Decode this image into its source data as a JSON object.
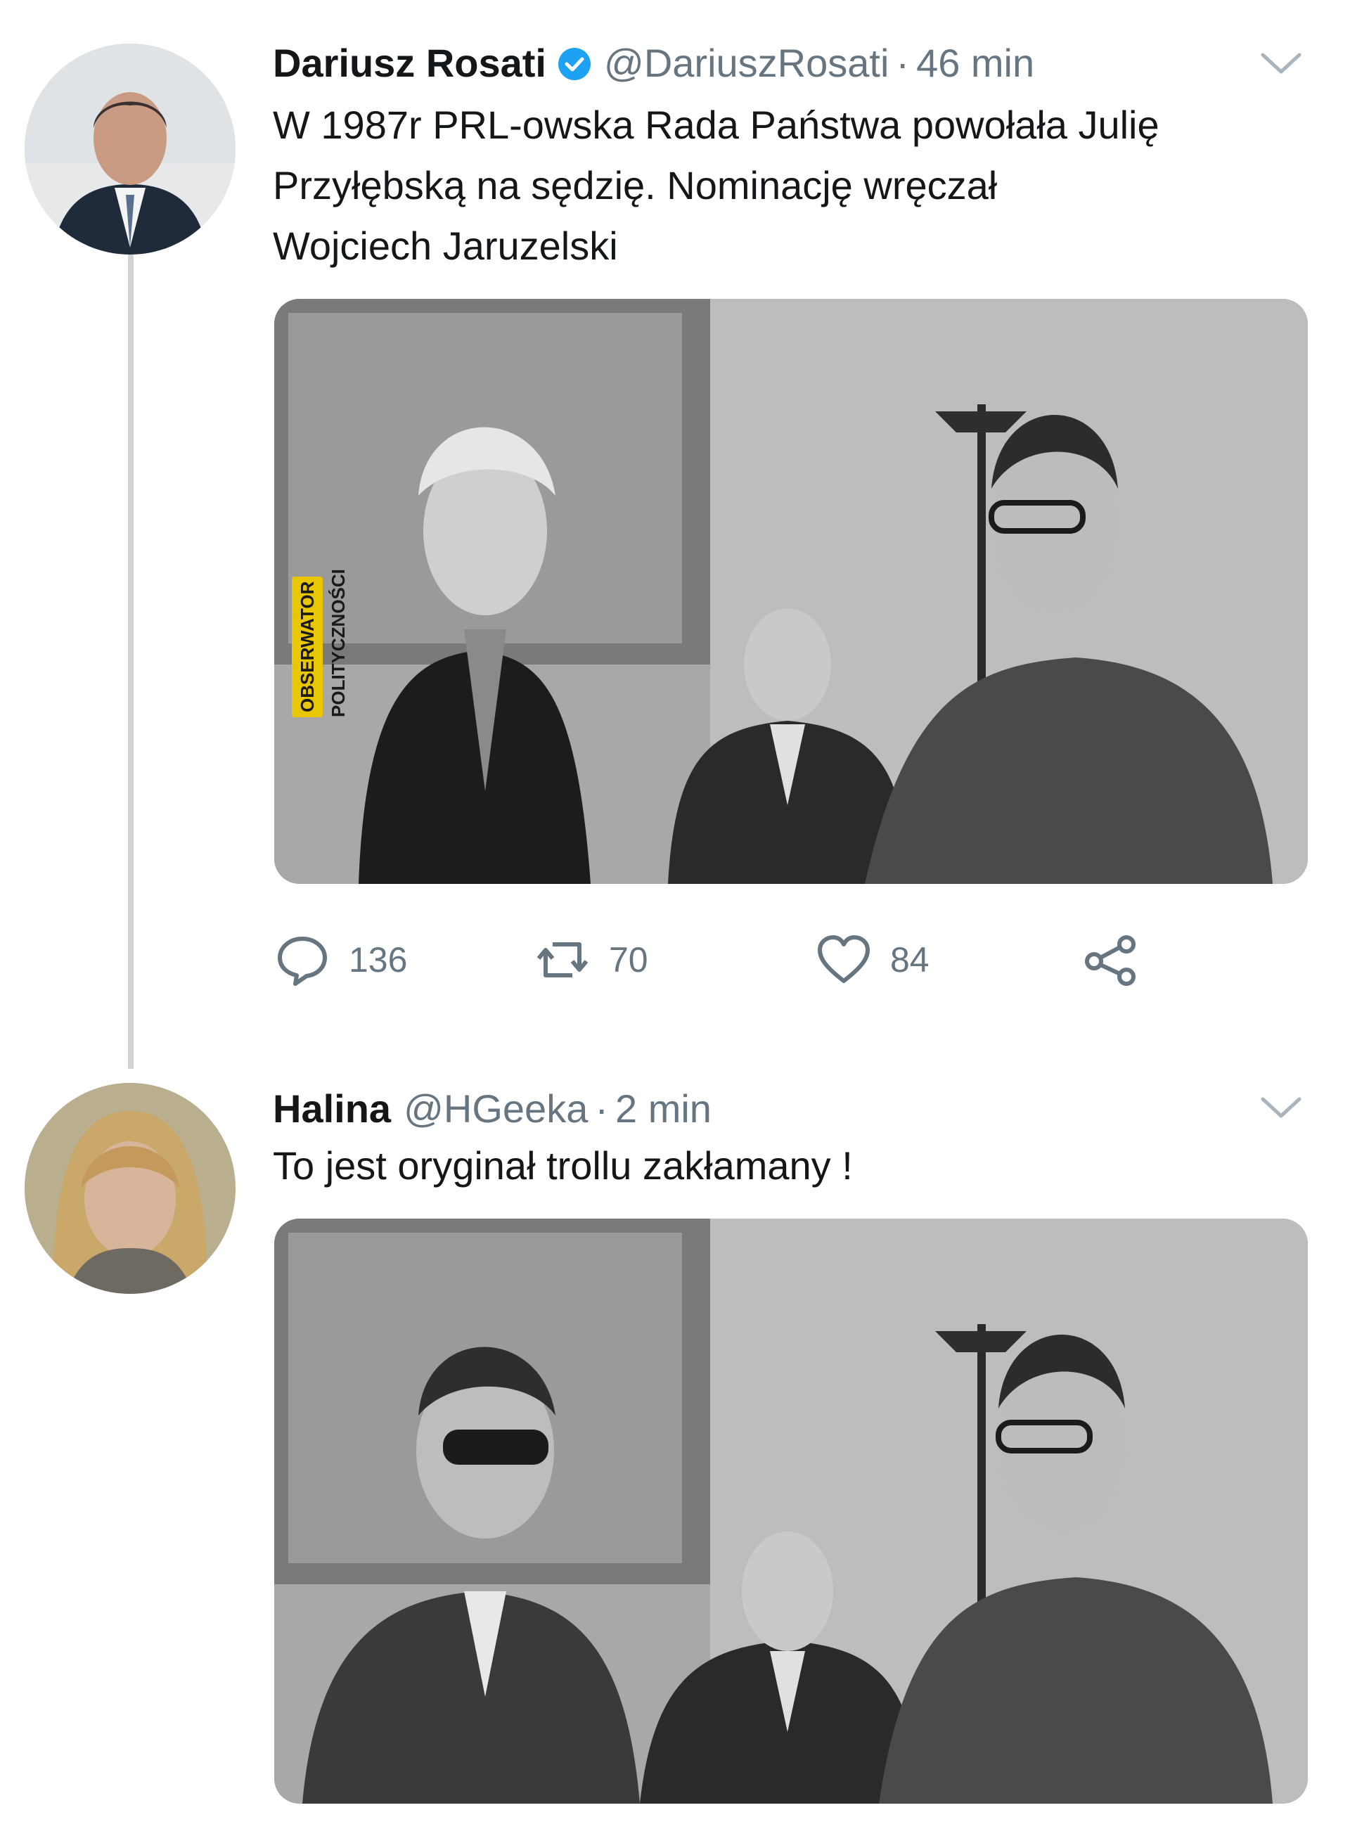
{
  "tweet": {
    "author_name": "Dariusz Rosati",
    "handle": "@DariuszRosati",
    "separator": "·",
    "time": "46 min",
    "text_lines": [
      "W 1987r  PRL-owska Rada Państwa powołała Julię",
      "Przyłębską na sędzię. Nominację wręczał",
      "Wojciech Jaruzelski"
    ],
    "watermark": "OBSERWATOR POLITYCZNOŚCI",
    "actions": {
      "replies": "136",
      "retweets": "70",
      "likes": "84"
    },
    "icons": {
      "verified": "verified-badge-icon",
      "menu": "chevron-down-icon",
      "reply": "reply-icon",
      "retweet": "retweet-icon",
      "like": "heart-icon",
      "share": "share-icon"
    }
  },
  "reply": {
    "author_name": "Halina",
    "handle": "@HGeeka",
    "separator": "·",
    "time": "2 min",
    "text": "To jest oryginał trollu zakłamany !"
  },
  "colors": {
    "text": "#14171a",
    "secondary": "#66757f",
    "verified": "#1da1f2",
    "thread_line": "#cfd3d6"
  }
}
